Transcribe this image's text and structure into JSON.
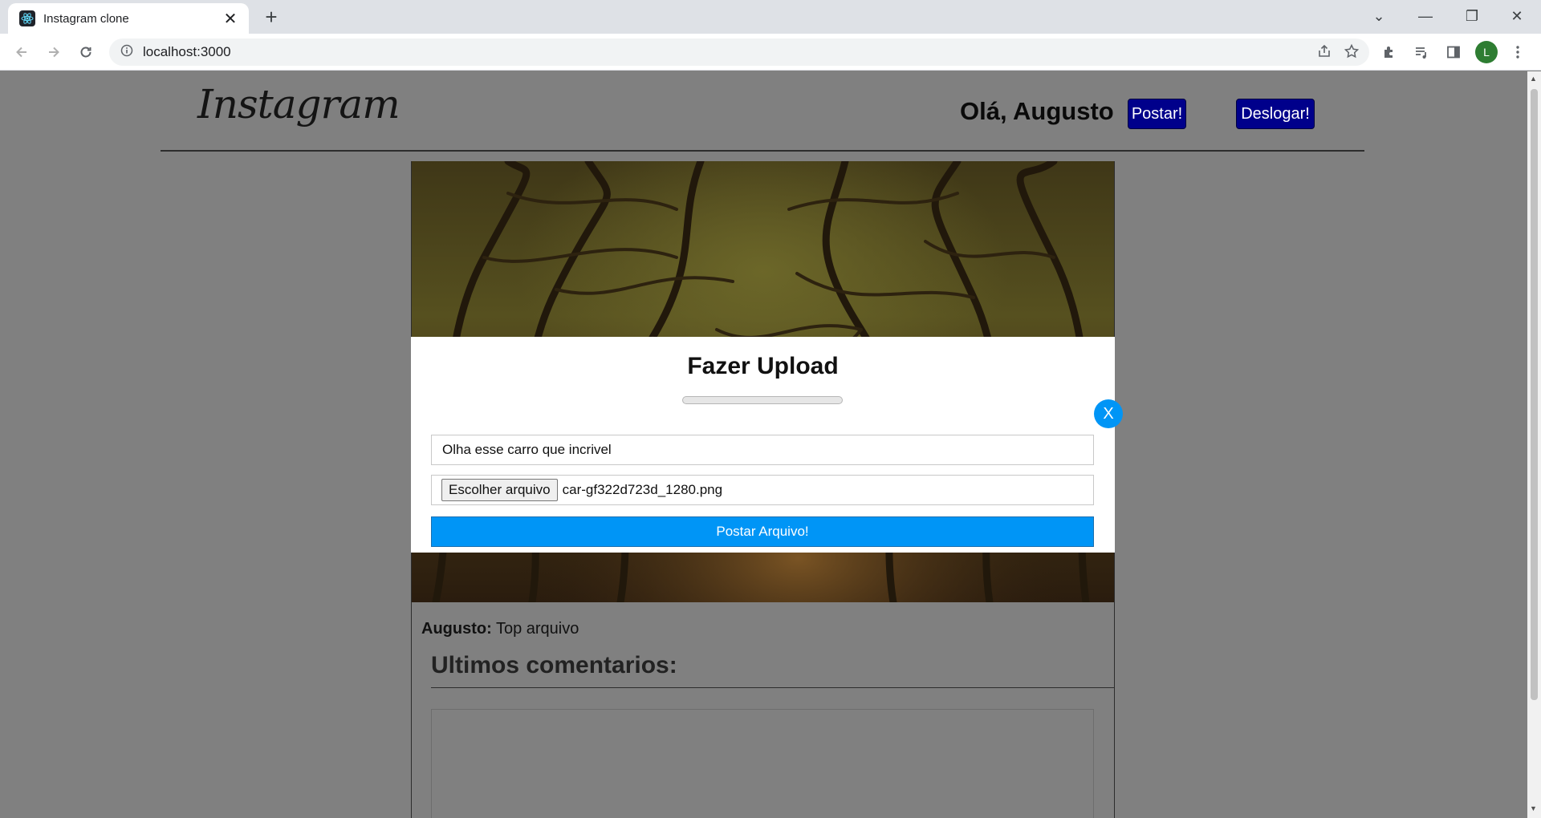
{
  "browser": {
    "tab_title": "Instagram clone",
    "tab_close": "✕",
    "new_tab": "+",
    "url": "localhost:3000",
    "profile_initial": "L",
    "window_controls": [
      "⌄",
      "—",
      "❐",
      "✕"
    ]
  },
  "header": {
    "logo": "Instagram",
    "greeting": "Olá, Augusto",
    "post_button": "Postar!",
    "logout_button": "Deslogar!"
  },
  "post": {
    "author": "Augusto:",
    "caption": " Top arquivo",
    "comments_title": "Ultimos comentarios:"
  },
  "modal": {
    "close_label": "X",
    "title": "Fazer Upload",
    "progress_value": 0,
    "caption_value": "Olha esse carro que incrivel",
    "file_button": "Escolher arquivo",
    "file_name": "car-gf322d723d_1280.png",
    "submit_label": "Postar Arquivo!"
  },
  "colors": {
    "overlay": "#808080",
    "accent": "#0095f6",
    "header_buttons": "#00008b"
  }
}
